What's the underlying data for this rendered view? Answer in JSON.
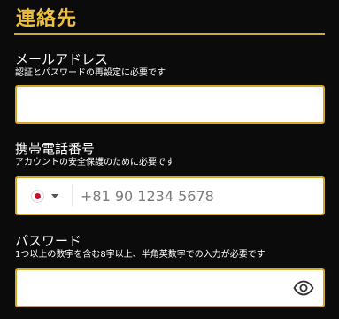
{
  "section": {
    "title": "連絡先"
  },
  "email": {
    "label": "メールアドレス",
    "hint": "認証とパスワードの再設定に必要です",
    "value": "",
    "placeholder": ""
  },
  "phone": {
    "label": "携帯電話番号",
    "hint": "アカウントの安全保護のために必要です",
    "country_flag": "japan-flag-icon",
    "value": "",
    "placeholder": "+81 90 1234 5678"
  },
  "password": {
    "label": "パスワード",
    "hint": "1つ以上の数字を含む8字以上、半角英数字での入力が必要です",
    "value": "",
    "placeholder": "",
    "toggle_icon": "eye-icon"
  },
  "colors": {
    "background": "#0b0b0b",
    "accent": "#d4aa2a",
    "title": "#ecbf3d",
    "text": "#ffffff",
    "input_bg": "#ffffff",
    "placeholder": "#7b7b7b",
    "flag_red": "#c8102e"
  }
}
